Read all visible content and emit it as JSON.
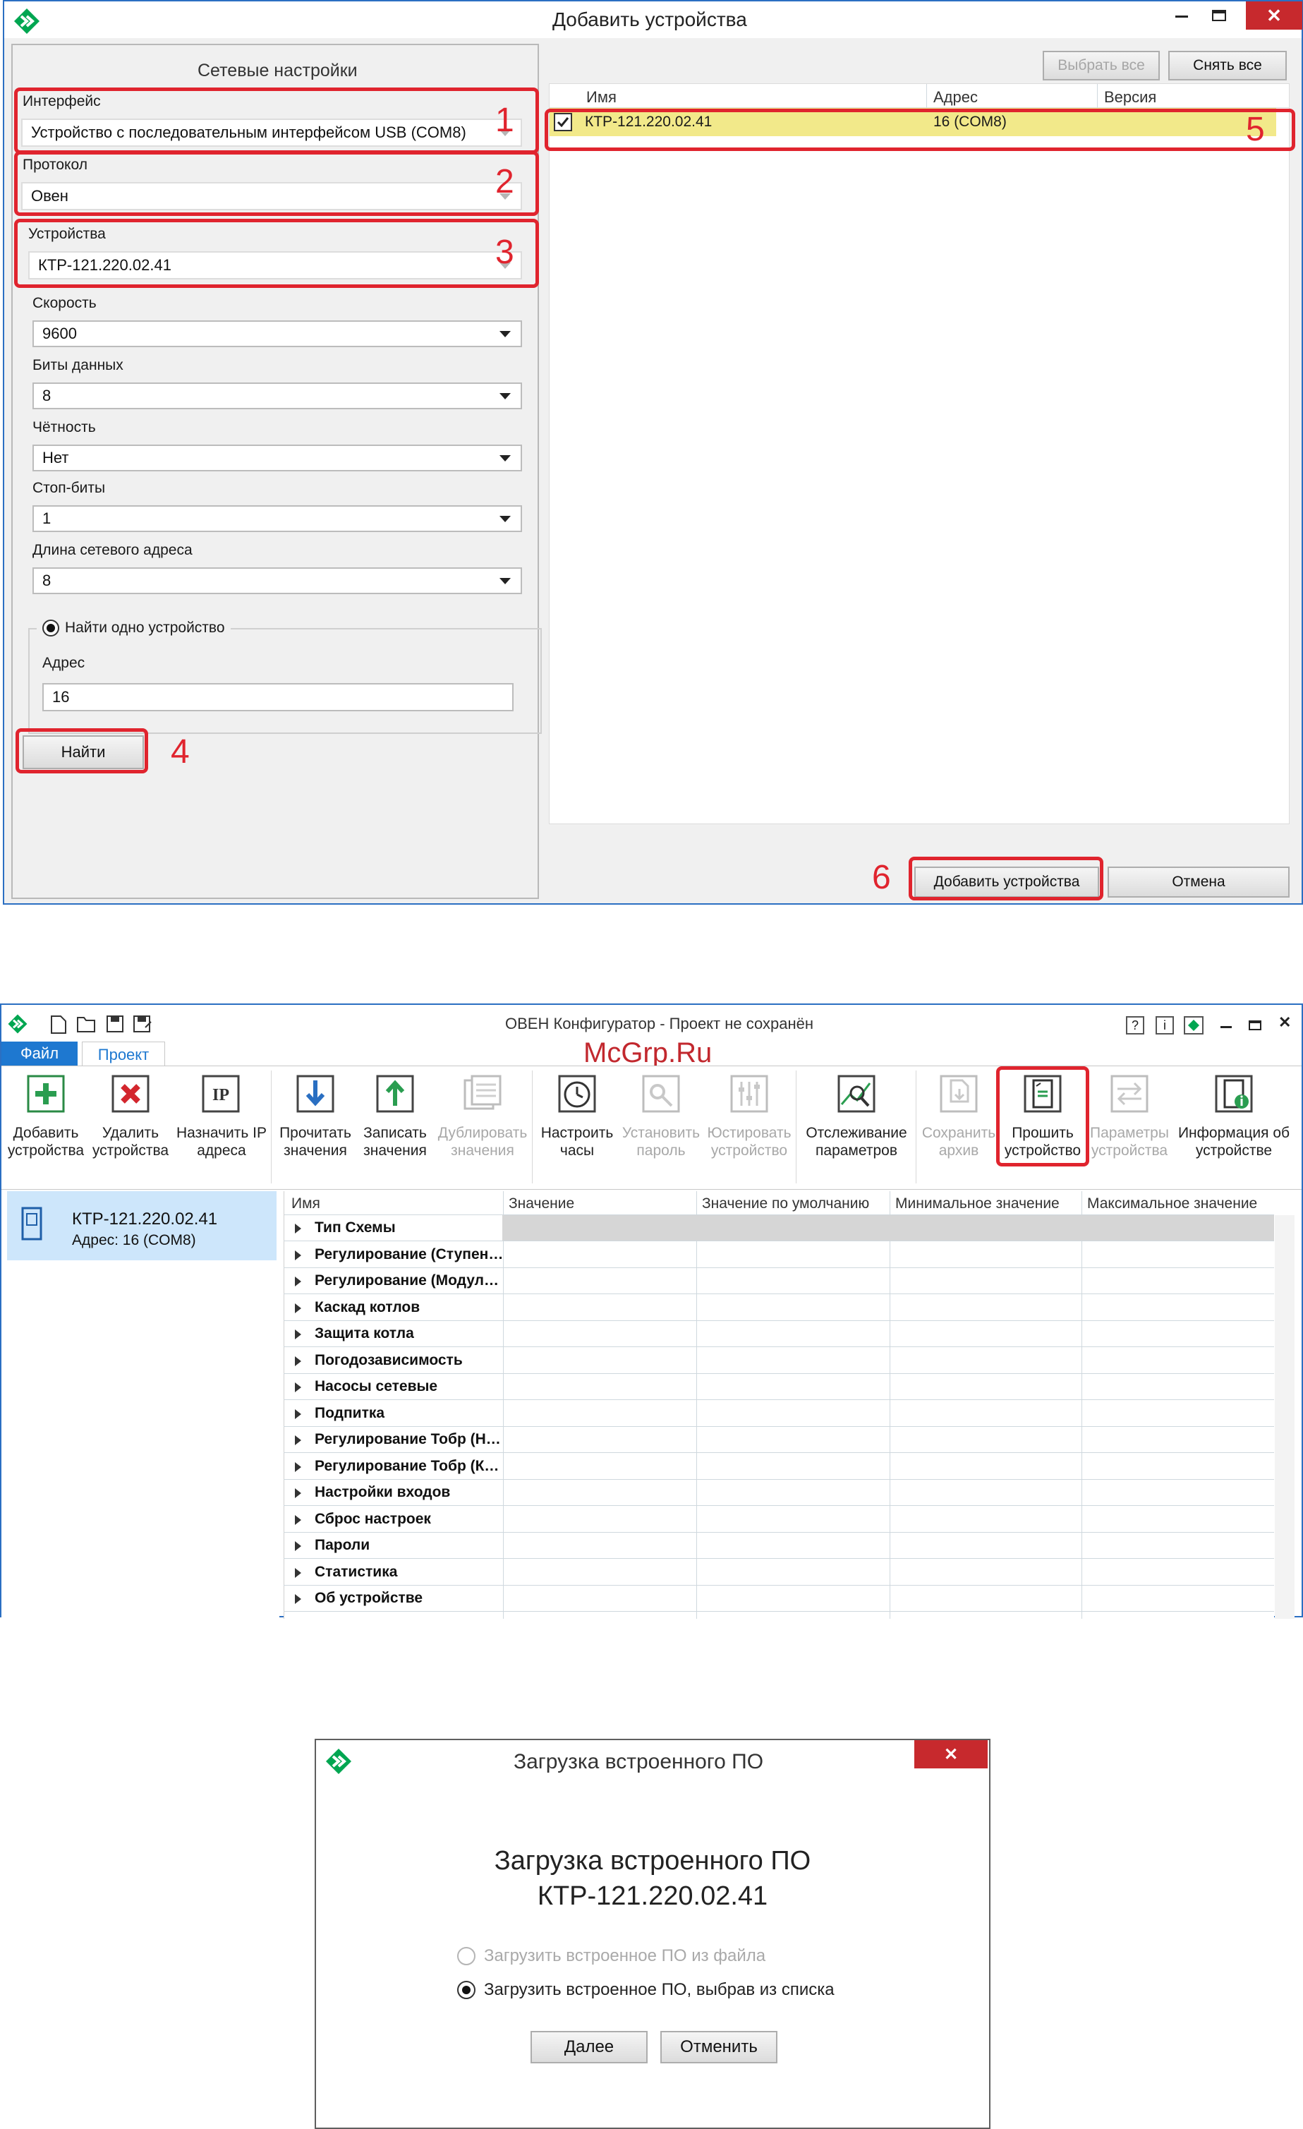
{
  "dialog1": {
    "title": "Добавить устройства",
    "net_title": "Сетевые настройки",
    "interface_label": "Интерфейс",
    "interface_value": "Устройство с последовательным интерфейсом USB (COM8)",
    "protocol_label": "Протокол",
    "protocol_value": "Овен",
    "devices_label": "Устройства",
    "devices_value": "КТР-121.220.02.41",
    "speed_label": "Скорость",
    "speed_value": "9600",
    "databits_label": "Биты данных",
    "databits_value": "8",
    "parity_label": "Чётность",
    "parity_value": "Нет",
    "stopbits_label": "Стоп-биты",
    "stopbits_value": "1",
    "addrlen_label": "Длина сетевого адреса",
    "addrlen_value": "8",
    "find_one_label": "Найти одно устройство",
    "address_label": "Адрес",
    "address_value": "16",
    "find_button": "Найти",
    "select_all": "Выбрать все",
    "deselect_all": "Снять все",
    "columns": [
      "Имя",
      "Адрес",
      "Версия"
    ],
    "device_row": {
      "name": "КТР-121.220.02.41",
      "address": "16 (COM8)",
      "version": ""
    },
    "add_button": "Добавить устройства",
    "cancel_button": "Отмена",
    "markers": [
      "1",
      "2",
      "3",
      "4",
      "5",
      "6"
    ]
  },
  "main": {
    "title": "ОВЕН Конфигуратор - Проект не сохранён",
    "watermark": "McGrp.Ru",
    "tabs": [
      "Файл",
      "Проект"
    ],
    "help_buttons": [
      "?",
      "i"
    ],
    "toolbar": [
      {
        "l1": "Добавить",
        "l2": "устройства",
        "enabled": true,
        "icon": "add-device-icon"
      },
      {
        "l1": "Удалить",
        "l2": "устройства",
        "enabled": true,
        "icon": "delete-device-icon"
      },
      {
        "l1": "Назначить IP",
        "l2": "адреса",
        "enabled": true,
        "icon": "ip-icon"
      },
      {
        "l1": "Прочитать",
        "l2": "значения",
        "enabled": true,
        "icon": "read-values-icon"
      },
      {
        "l1": "Записать",
        "l2": "значения",
        "enabled": true,
        "icon": "write-values-icon"
      },
      {
        "l1": "Дублировать",
        "l2": "значения",
        "enabled": false,
        "icon": "duplicate-icon"
      },
      {
        "l1": "Настроить",
        "l2": "часы",
        "enabled": true,
        "icon": "clock-icon"
      },
      {
        "l1": "Установить",
        "l2": "пароль",
        "enabled": false,
        "icon": "password-icon"
      },
      {
        "l1": "Юстировать",
        "l2": "устройство",
        "enabled": false,
        "icon": "calibrate-icon"
      },
      {
        "l1": "Отслеживание",
        "l2": "параметров",
        "enabled": true,
        "icon": "monitor-icon"
      },
      {
        "l1": "Сохранить",
        "l2": "архив",
        "enabled": false,
        "icon": "save-archive-icon"
      },
      {
        "l1": "Прошить",
        "l2": "устройство",
        "enabled": true,
        "icon": "firmware-icon"
      },
      {
        "l1": "Параметры",
        "l2": "устройства",
        "enabled": false,
        "icon": "device-params-icon"
      },
      {
        "l1": "Информация об",
        "l2": "устройстве",
        "enabled": true,
        "icon": "device-info-icon"
      }
    ],
    "device": {
      "name": "КТР-121.220.02.41",
      "address": "Адрес: 16 (COM8)"
    },
    "columns": [
      "Имя",
      "Значение",
      "Значение по умолчанию",
      "Минимальное значение",
      "Максимальное значение"
    ],
    "rows": [
      "Тип Схемы",
      "Регулирование (Ступен…",
      "Регулирование (Модул…",
      "Каскад котлов",
      "Защита котла",
      "Погодозависимость",
      "Насосы сетевые",
      "Подпитка",
      "Регулирование Тобр (Н…",
      "Регулирование Тобр (К…",
      "Настройки входов",
      "Сброс настроек",
      "Пароли",
      "Статистика",
      "Об устройстве"
    ]
  },
  "dialog2": {
    "title": "Загрузка встроенного ПО",
    "heading": "Загрузка встроенного ПО",
    "device": "КТР-121.220.02.41",
    "option_file": "Загрузить встроенное ПО из файла",
    "option_list": "Загрузить встроенное ПО, выбрав из списка",
    "next_button": "Далее",
    "cancel_button": "Отменить"
  },
  "colors": {
    "accent": "#00a651",
    "marker": "#e0242e",
    "row_highlight": "#f2e98a",
    "selection": "#cde6fb"
  }
}
